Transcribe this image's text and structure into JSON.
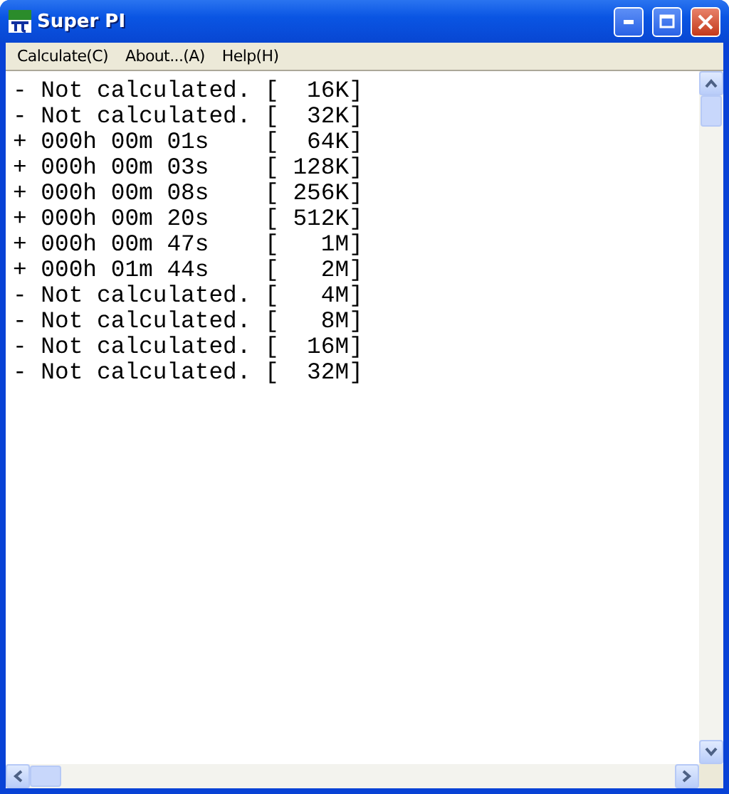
{
  "window": {
    "title": "Super PI"
  },
  "menu": [
    "Calculate(C)",
    "About...(A)",
    "Help(H)"
  ],
  "lines": [
    "- Not calculated. [  16K]",
    "- Not calculated. [  32K]",
    "+ 000h 00m 01s    [  64K]",
    "+ 000h 00m 03s    [ 128K]",
    "+ 000h 00m 08s    [ 256K]",
    "+ 000h 00m 20s    [ 512K]",
    "+ 000h 00m 47s    [   1M]",
    "+ 000h 01m 44s    [   2M]",
    "- Not calculated. [   4M]",
    "- Not calculated. [   8M]",
    "- Not calculated. [  16M]",
    "- Not calculated. [  32M]"
  ]
}
